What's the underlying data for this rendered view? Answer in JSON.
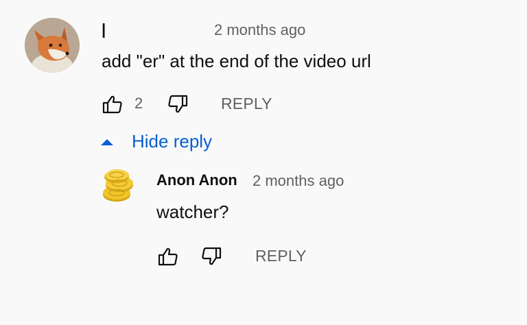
{
  "comment": {
    "author": "|",
    "time": "2 months ago",
    "text": "add \"er\" at the end of the video url",
    "like_count": "2",
    "reply_label": "REPLY",
    "avatar_icon": "fox-avatar",
    "toggle_label": "Hide reply"
  },
  "reply": {
    "author": "Anon Anon",
    "time": "2 months ago",
    "text": "watcher?",
    "reply_label": "REPLY",
    "avatar_icon": "coins-avatar"
  },
  "colors": {
    "background": "#f9f9f9",
    "text_primary": "#0f0f0f",
    "text_secondary": "#606060",
    "link_blue": "#065fd4"
  }
}
